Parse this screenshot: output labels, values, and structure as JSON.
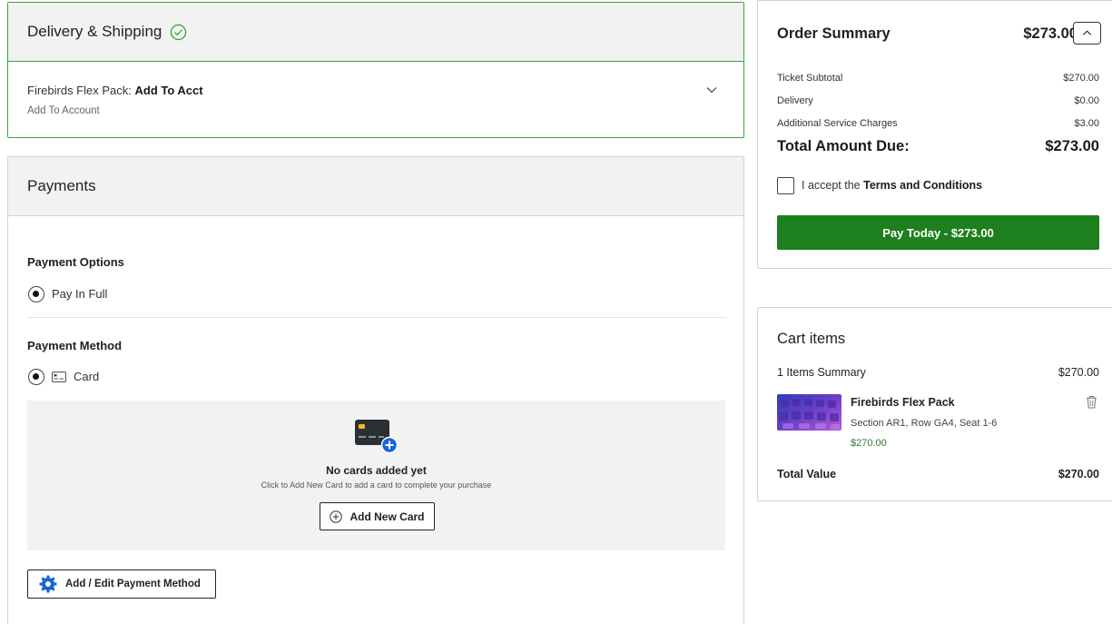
{
  "delivery": {
    "title": "Delivery & Shipping",
    "item_name": "Firebirds Flex Pack",
    "item_separator": ": ",
    "item_method": "Add To Acct",
    "item_sub": "Add To Account"
  },
  "payments": {
    "title": "Payments",
    "options_label": "Payment Options",
    "option_pay_in_full": "Pay In Full",
    "method_label": "Payment Method",
    "method_card": "Card",
    "no_cards_title": "No cards added yet",
    "no_cards_desc": "Click to Add New Card to add a card to complete your purchase",
    "add_card_label": "Add New Card",
    "edit_method_label": "Add / Edit Payment Method"
  },
  "summary": {
    "title": "Order Summary",
    "total_top": "$273.00",
    "rows": [
      {
        "label": "Ticket Subtotal",
        "value": "$270.00"
      },
      {
        "label": "Delivery",
        "value": "$0.00"
      },
      {
        "label": "Additional Service Charges",
        "value": "$3.00"
      }
    ],
    "grand_label": "Total Amount Due:",
    "grand_value": "$273.00",
    "terms_prefix": "I accept the ",
    "terms_link": "Terms and Conditions",
    "pay_button": "Pay Today - $273.00"
  },
  "cart": {
    "title": "Cart items",
    "summary_label": "1 Items Summary",
    "summary_value": "$270.00",
    "item": {
      "name": "Firebirds Flex Pack",
      "seat": "Section AR1, Row GA4, Seat 1-6",
      "price": "$270.00"
    },
    "total_label": "Total Value",
    "total_value": "$270.00"
  },
  "colors": {
    "success_border": "#3aa43a",
    "pay_button": "#1d7f1d",
    "price_green": "#2f7a2f",
    "icon_blue": "#1565d8"
  }
}
